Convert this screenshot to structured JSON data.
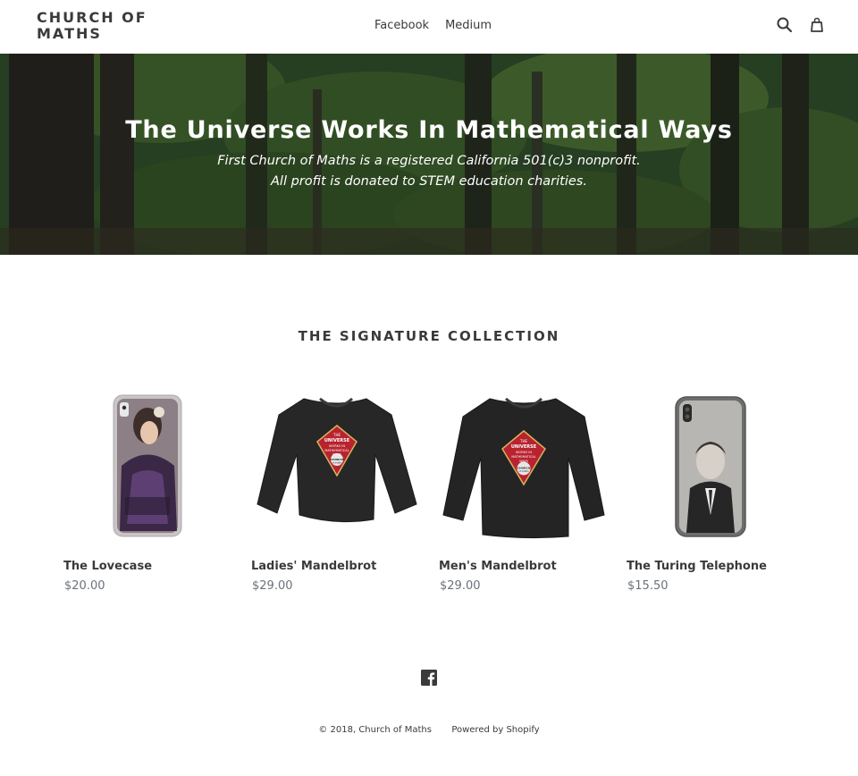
{
  "header": {
    "logo_text": "CHURCH OF MATHS",
    "nav": [
      "Facebook",
      "Medium"
    ],
    "icons": [
      "search-icon",
      "cart-icon"
    ]
  },
  "hero": {
    "title": "The Universe Works In Mathematical Ways",
    "subtitle_line1": "First Church of Maths is a registered California 501(c)3 nonprofit.",
    "subtitle_line2": "All profit is donated to STEM education charities."
  },
  "collection": {
    "title": "THE SIGNATURE COLLECTION",
    "products": [
      {
        "name": "The Lovecase",
        "price": "$20.00",
        "image": "phone-case-portrait-woman"
      },
      {
        "name": "Ladies' Mandelbrot",
        "price": "$29.00",
        "image": "black-long-sleeve-shirt-ladies"
      },
      {
        "name": "Men's Mandelbrot",
        "price": "$29.00",
        "image": "black-long-sleeve-shirt-mens"
      },
      {
        "name": "The Turing Telephone",
        "price": "$15.50",
        "image": "phone-case-portrait-man"
      }
    ],
    "shirt_graphic_lines": [
      "THE",
      "UNIVERSE",
      "WORKS IN",
      "MATHEMATICAL",
      "WAYS",
      "CHURCH",
      "of maths"
    ]
  },
  "footer": {
    "social_icon": "facebook-icon",
    "copyright": "© 2018, Church of Maths",
    "powered": "Powered by Shopify"
  },
  "colors": {
    "text": "#3a3a3a",
    "price": "#69727b",
    "shirt": "#272727",
    "shirt_badge": "#b8232f",
    "hero_green": "#31522c"
  }
}
